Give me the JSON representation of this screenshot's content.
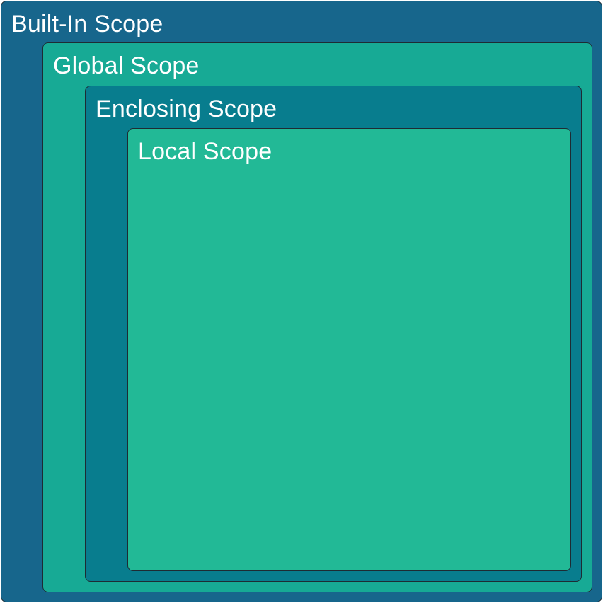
{
  "scopes": [
    {
      "label": "Built-In Scope",
      "color": "#17668c"
    },
    {
      "label": "Global Scope",
      "color": "#17aa95"
    },
    {
      "label": "Enclosing Scope",
      "color": "#087d8e"
    },
    {
      "label": "Local Scope",
      "color": "#22b996"
    }
  ]
}
